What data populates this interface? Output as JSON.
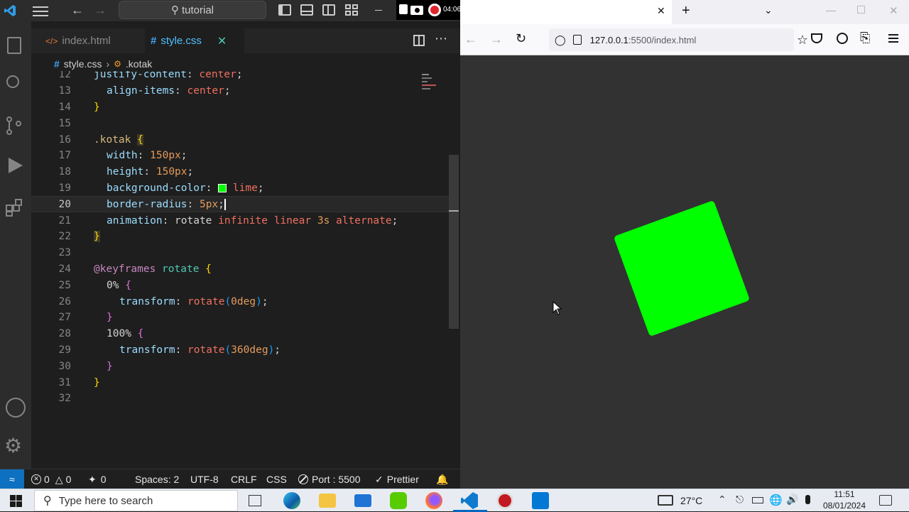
{
  "vscode": {
    "search_text": "tutorial",
    "tabs": [
      {
        "label": "index.html"
      },
      {
        "label": "style.css"
      }
    ],
    "breadcrumb": {
      "file": "style.css",
      "symbol": ".kotak"
    },
    "code_lines": [
      {
        "n": "12",
        "text": "  justify-content: center;"
      },
      {
        "n": "13",
        "text": "  align-items: center;"
      },
      {
        "n": "14",
        "text": "}"
      },
      {
        "n": "15",
        "text": ""
      },
      {
        "n": "16",
        "text": ".kotak {"
      },
      {
        "n": "17",
        "text": "  width: 150px;"
      },
      {
        "n": "18",
        "text": "  height: 150px;"
      },
      {
        "n": "19",
        "text": "  background-color:   lime;"
      },
      {
        "n": "20",
        "text": "  border-radius: 5px;"
      },
      {
        "n": "21",
        "text": "  animation: rotate infinite linear 3s alternate;"
      },
      {
        "n": "22",
        "text": "}"
      },
      {
        "n": "23",
        "text": ""
      },
      {
        "n": "24",
        "text": "@keyframes rotate {"
      },
      {
        "n": "25",
        "text": "  0% {"
      },
      {
        "n": "26",
        "text": "    transform: rotate(0deg);"
      },
      {
        "n": "27",
        "text": "  }"
      },
      {
        "n": "28",
        "text": "  100% {"
      },
      {
        "n": "29",
        "text": "    transform: rotate(360deg);"
      },
      {
        "n": "30",
        "text": "  }"
      },
      {
        "n": "31",
        "text": "}"
      },
      {
        "n": "32",
        "text": ""
      }
    ],
    "status": {
      "errors": "0",
      "warnings": "0",
      "ports": "0",
      "spaces": "Spaces: 2",
      "encoding": "UTF-8",
      "eol": "CRLF",
      "language": "CSS",
      "port": "Port : 5500",
      "prettier": "Prettier"
    },
    "colors": {
      "lime_swatch": "#00ff00"
    }
  },
  "recorder": {
    "time": "04:06"
  },
  "browser": {
    "url_host": "127.0.0.1",
    "url_path": ":5500/index.html",
    "box_color": "#00ff00"
  },
  "taskbar": {
    "search_placeholder": "Type here to search",
    "weather": "27°C",
    "time": "11:51",
    "date": "08/01/2024"
  }
}
